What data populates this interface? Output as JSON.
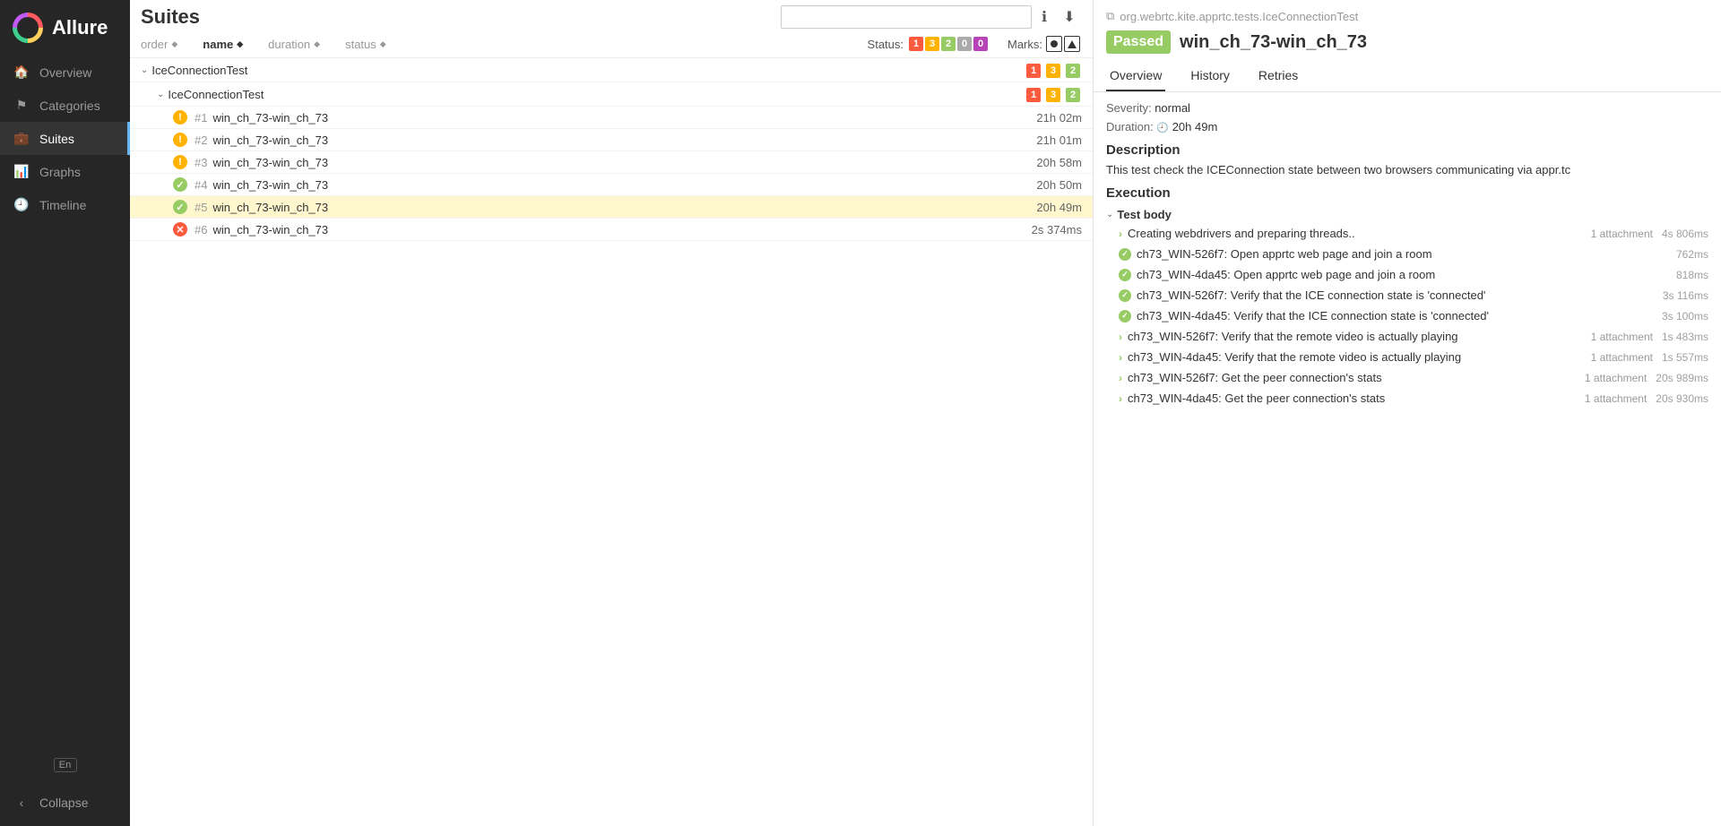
{
  "app_name": "Allure",
  "lang_badge": "En",
  "sidebar": {
    "items": [
      {
        "label": "Overview",
        "icon": "🏠"
      },
      {
        "label": "Categories",
        "icon": "⚑"
      },
      {
        "label": "Suites",
        "icon": "💼"
      },
      {
        "label": "Graphs",
        "icon": "📊"
      },
      {
        "label": "Timeline",
        "icon": "🕘"
      }
    ],
    "collapse": "Collapse"
  },
  "main": {
    "title": "Suites",
    "sorters": [
      "order",
      "name",
      "duration",
      "status"
    ],
    "status_label": "Status:",
    "status_counts": [
      "1",
      "3",
      "2",
      "0",
      "0"
    ],
    "marks_label": "Marks:",
    "groups": [
      {
        "name": "IceConnectionTest",
        "pills": [
          "1",
          "3",
          "2"
        ]
      },
      {
        "name": "IceConnectionTest",
        "pills": [
          "1",
          "3",
          "2"
        ]
      }
    ],
    "rows": [
      {
        "num": "#1",
        "name": "win_ch_73-win_ch_73",
        "dur": "21h 02m",
        "status": "orange"
      },
      {
        "num": "#2",
        "name": "win_ch_73-win_ch_73",
        "dur": "21h 01m",
        "status": "orange"
      },
      {
        "num": "#3",
        "name": "win_ch_73-win_ch_73",
        "dur": "20h 58m",
        "status": "orange"
      },
      {
        "num": "#4",
        "name": "win_ch_73-win_ch_73",
        "dur": "20h 50m",
        "status": "green"
      },
      {
        "num": "#5",
        "name": "win_ch_73-win_ch_73",
        "dur": "20h 49m",
        "status": "green"
      },
      {
        "num": "#6",
        "name": "win_ch_73-win_ch_73",
        "dur": "2s 374ms",
        "status": "red"
      }
    ]
  },
  "detail": {
    "breadcrumb": "org.webrtc.kite.apprtc.tests.IceConnectionTest",
    "status_badge": "Passed",
    "title": "win_ch_73-win_ch_73",
    "tabs": [
      "Overview",
      "History",
      "Retries"
    ],
    "severity_label": "Severity:",
    "severity": "normal",
    "duration_label": "Duration:",
    "duration": "20h 49m",
    "description_h": "Description",
    "description": "This test check the ICEConnection state between two browsers communicating via appr.tc",
    "execution_h": "Execution",
    "test_body": "Test body",
    "steps": [
      {
        "kind": "chev",
        "text": "Creating webdrivers and preparing threads..",
        "attach": "1 attachment",
        "dur": "4s 806ms"
      },
      {
        "kind": "dot",
        "text": "ch73_WIN-526f7: Open apprtc web page and join a room",
        "dur": "762ms"
      },
      {
        "kind": "dot",
        "text": "ch73_WIN-4da45: Open apprtc web page and join a room",
        "dur": "818ms"
      },
      {
        "kind": "dot",
        "text": "ch73_WIN-526f7: Verify that the ICE connection state is 'connected'",
        "dur": "3s 116ms"
      },
      {
        "kind": "dot",
        "text": "ch73_WIN-4da45: Verify that the ICE connection state is 'connected'",
        "dur": "3s 100ms"
      },
      {
        "kind": "chev",
        "text": "ch73_WIN-526f7: Verify that the remote video is actually playing",
        "attach": "1 attachment",
        "dur": "1s 483ms"
      },
      {
        "kind": "chev",
        "text": "ch73_WIN-4da45: Verify that the remote video is actually playing",
        "attach": "1 attachment",
        "dur": "1s 557ms"
      },
      {
        "kind": "chev",
        "text": "ch73_WIN-526f7: Get the peer connection's stats",
        "attach": "1 attachment",
        "dur": "20s 989ms"
      },
      {
        "kind": "chev",
        "text": "ch73_WIN-4da45: Get the peer connection's stats",
        "attach": "1 attachment",
        "dur": "20s 930ms"
      }
    ]
  }
}
